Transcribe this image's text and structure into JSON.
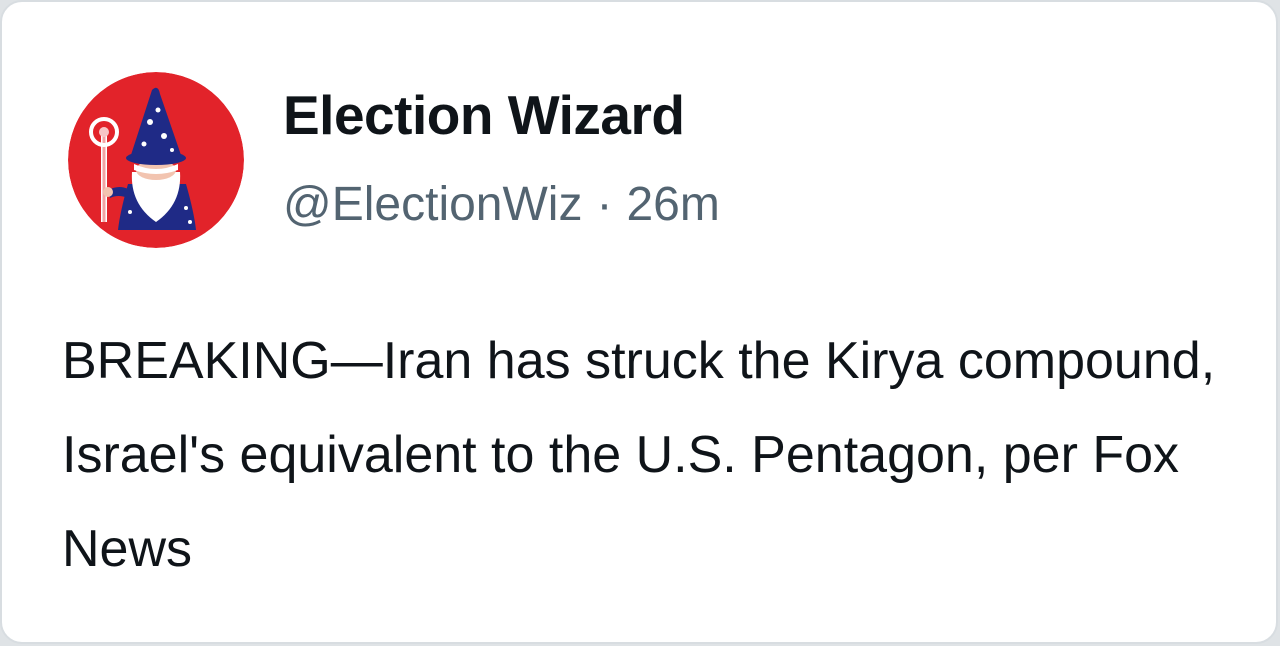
{
  "tweet": {
    "display_name": "Election Wizard",
    "handle": "@ElectionWiz",
    "separator": "·",
    "timestamp": "26m",
    "text": "BREAKING—Iran has struck the Kirya compound, Israel's equivalent to the U.S. Pentagon, per Fox News",
    "avatar": {
      "icon": "wizard-gnome-icon",
      "background_color": "#e2232a",
      "hat_color": "#1f2a86"
    }
  },
  "colors": {
    "name_text": "#0f1419",
    "meta_text": "#536471",
    "card_background": "#ffffff",
    "card_border": "#d8dde1"
  }
}
